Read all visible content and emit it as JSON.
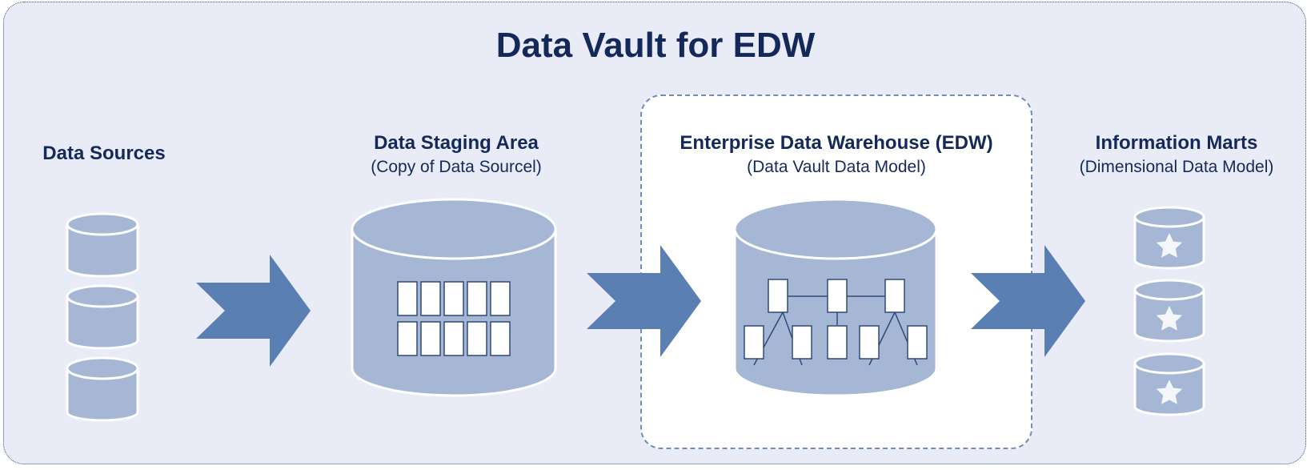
{
  "title": "Data Vault for EDW",
  "sections": {
    "sources": {
      "heading": "Data Sources"
    },
    "staging": {
      "heading": "Data Staging Area",
      "subheading": "(Copy of Data Sourcel)"
    },
    "edw": {
      "heading": "Enterprise Data Warehouse (EDW)",
      "subheading": "(Data Vault Data Model)"
    },
    "marts": {
      "heading": "Information Marts",
      "subheading": "(Dimensional Data Model)"
    }
  },
  "colors": {
    "background": "#e9ecf6",
    "cylinder_fill": "#a5b7d4",
    "arrow_fill": "#5a7fb2",
    "text": "#14295a",
    "edw_border": "#6f8db9"
  },
  "icons": {
    "database": "database-icon",
    "arrow": "right-arrow-icon",
    "star": "star-icon"
  }
}
